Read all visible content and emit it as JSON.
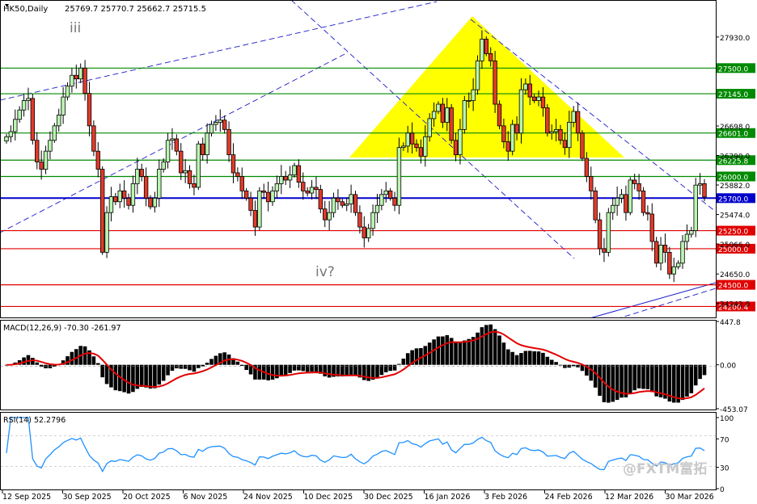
{
  "header": {
    "symbol": "HK50,Daily",
    "ohlc": "25769.7 25770.7 25662.7 25715.5"
  },
  "watermark": "@FXTM富拓",
  "colors": {
    "bull_candle": "#b9f5b0",
    "bear_candle": "#e23a2a",
    "support": "#e00000",
    "resistance": "#008a00",
    "current": "#0000cc",
    "triangle": "#ffff00",
    "macd_bar": "#000000",
    "macd_signal": "#e00000",
    "rsi_line": "#1e90ff"
  },
  "chart_data": [
    {
      "type": "candlestick",
      "name": "price",
      "ylim": [
        24060,
        28420
      ],
      "y_ticks": [
        "27930.0",
        "26698.0",
        "26290.0",
        "25882.0",
        "25474.0",
        "25066.0",
        "24650.0",
        "24242.0"
      ],
      "x_labels": [
        "12 Sep 2025",
        "30 Sep 2025",
        "20 Oct 2025",
        "6 Nov 2025",
        "24 Nov 2025",
        "10 Dec 2025",
        "30 Dec 2025",
        "16 Jan 2026",
        "3 Feb 2026",
        "24 Feb 2026",
        "12 Mar 2026",
        "30 Mar 2026"
      ],
      "levels": [
        {
          "value": 27500,
          "label": "27500.0",
          "kind": "resistance"
        },
        {
          "value": 27145,
          "label": "27145.0",
          "kind": "resistance"
        },
        {
          "value": 26601,
          "label": "26601.0",
          "kind": "resistance"
        },
        {
          "value": 26225.8,
          "label": "26225.8",
          "kind": "resistance"
        },
        {
          "value": 26000,
          "label": "26000.0",
          "kind": "resistance"
        },
        {
          "value": 25700,
          "label": "25700.0",
          "kind": "current"
        },
        {
          "value": 25250,
          "label": "25250.0",
          "kind": "support"
        },
        {
          "value": 25000,
          "label": "25000.0",
          "kind": "support"
        },
        {
          "value": 24500,
          "label": "24500.0",
          "kind": "support"
        },
        {
          "value": 24200.4,
          "label": "24200.4",
          "kind": "support"
        }
      ],
      "annotations": [
        "iii",
        "iv?"
      ],
      "closes": [
        26550,
        26620,
        26790,
        26920,
        27050,
        27080,
        26500,
        26200,
        26100,
        26350,
        26500,
        26700,
        26850,
        27100,
        27250,
        27400,
        27350,
        27500,
        27150,
        26700,
        26350,
        26100,
        24950,
        25500,
        25720,
        25650,
        25800,
        25700,
        25600,
        25900,
        26100,
        26000,
        25700,
        25580,
        25700,
        26100,
        26200,
        26500,
        26520,
        26350,
        26050,
        26080,
        25900,
        25850,
        26450,
        26300,
        26600,
        26720,
        26750,
        26780,
        26650,
        26300,
        26050,
        26000,
        25800,
        25700,
        25530,
        25300,
        25800,
        25780,
        25650,
        25800,
        25900,
        26000,
        25950,
        26020,
        26150,
        25920,
        25800,
        25770,
        25850,
        25820,
        25550,
        25400,
        25500,
        25700,
        25650,
        25600,
        25620,
        25750,
        25500,
        25300,
        25150,
        25280,
        25500,
        25600,
        25750,
        25800,
        25700,
        25600,
        26400,
        26420,
        26600,
        26450,
        26400,
        26280,
        26550,
        26800,
        26900,
        27000,
        26750,
        26950,
        26500,
        26300,
        26650,
        27050,
        27050,
        27200,
        27600,
        27900,
        27700,
        27600,
        27000,
        26700,
        26480,
        26350,
        26720,
        26600,
        27200,
        27280,
        27100,
        27050,
        27100,
        26950,
        26600,
        26620,
        26650,
        26500,
        26400,
        26750,
        26900,
        26600,
        26250,
        26000,
        25800,
        25400,
        25000,
        24950,
        25500,
        25600,
        25700,
        25750,
        25500,
        25950,
        25900,
        25800,
        25500,
        25480,
        25100,
        24800,
        25050,
        24950,
        24650,
        24750,
        24800,
        25100,
        25200,
        25250,
        25880,
        25900,
        25715
      ]
    },
    {
      "type": "bar",
      "name": "macd",
      "title": "MACD(12,26,9) -70.30 -261.97",
      "ylim": [
        -453.07,
        447.8
      ],
      "y_ticks": [
        "447.8",
        "0.00",
        "-453.07"
      ]
    },
    {
      "type": "line",
      "name": "rsi",
      "title": "RSI(14) 52.2796",
      "ylim": [
        0,
        100
      ],
      "y_ticks": [
        "100",
        "70",
        "30",
        "0"
      ]
    }
  ]
}
